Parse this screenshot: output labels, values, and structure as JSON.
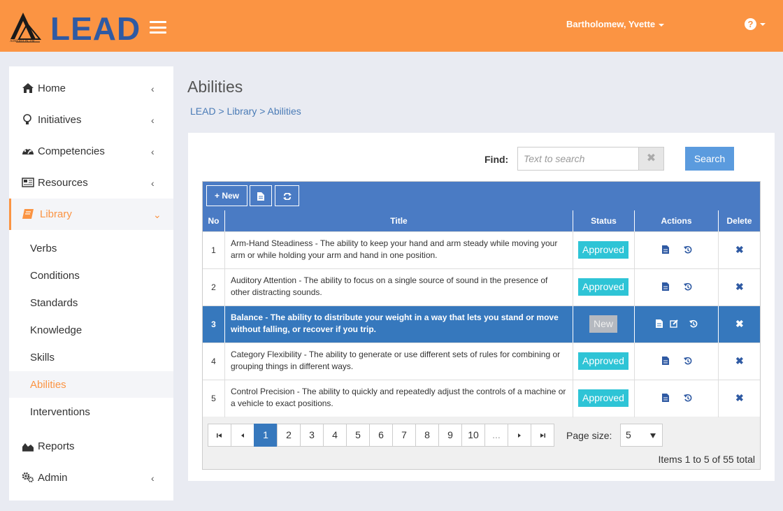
{
  "header": {
    "logo_text": "LEAD",
    "logo_sub": "AIMEREON, INC",
    "user_name": "Bartholomew, Yvette",
    "help_glyph": "?",
    "bg_color": "#fb9443",
    "icons": [
      "hamburger-menu-icon",
      "user-caret-icon",
      "help-icon"
    ]
  },
  "sidebar": {
    "items": [
      {
        "label": "Home",
        "icon": "home-icon",
        "chevron": "‹"
      },
      {
        "label": "Initiatives",
        "icon": "lightbulb-icon",
        "chevron": "‹"
      },
      {
        "label": "Competencies",
        "icon": "dashboard-icon",
        "chevron": "‹"
      },
      {
        "label": "Resources",
        "icon": "newspaper-icon",
        "chevron": "‹"
      },
      {
        "label": "Library",
        "icon": "book-icon",
        "chevron": "⌄",
        "active": true
      },
      {
        "label": "Reports",
        "icon": "area-chart-icon"
      },
      {
        "label": "Admin",
        "icon": "gears-icon",
        "chevron": "‹"
      }
    ],
    "library_children": [
      {
        "label": "Verbs"
      },
      {
        "label": "Conditions"
      },
      {
        "label": "Standards"
      },
      {
        "label": "Knowledge"
      },
      {
        "label": "Skills"
      },
      {
        "label": "Abilities",
        "active": true
      },
      {
        "label": "Interventions"
      }
    ]
  },
  "main": {
    "title": "Abilities",
    "breadcrumb": "LEAD > Library > Abilities",
    "find_label": "Find:",
    "search_placeholder": "Text to search",
    "clear_glyph": "✖",
    "search_button": "Search",
    "toolbar": {
      "new_label": "+ New",
      "export_icon": "document-icon",
      "refresh_icon": "refresh-icon"
    },
    "columns": [
      "No",
      "Title",
      "Status",
      "Actions",
      "Delete"
    ],
    "rows": [
      {
        "no": "1",
        "title": "Arm-Hand Steadiness - The ability to keep your hand and arm steady while moving your arm or while holding your arm and hand in one position.",
        "status": "Approved",
        "selected": false
      },
      {
        "no": "2",
        "title": "Auditory Attention - The ability to focus on a single source of sound in the presence of other distracting sounds.",
        "status": "Approved",
        "selected": false
      },
      {
        "no": "3",
        "title": "Balance - The ability to distribute your weight in a way that lets you stand or move without falling, or recover if you trip.",
        "status": "New",
        "selected": true
      },
      {
        "no": "4",
        "title": "Category Flexibility - The ability to generate or use different sets of rules for combining or grouping things in different ways.",
        "status": "Approved",
        "selected": false
      },
      {
        "no": "5",
        "title": "Control Precision - The ability to quickly and repeatedly adjust the controls of a machine or a vehicle to exact positions.",
        "status": "Approved",
        "selected": false
      }
    ],
    "delete_glyph": "✖",
    "pager": {
      "first": "⏮",
      "prev": "◂",
      "pages": [
        "1",
        "2",
        "3",
        "4",
        "5",
        "6",
        "7",
        "8",
        "9",
        "10",
        "..."
      ],
      "current": "1",
      "next": "▸",
      "last": "⏭",
      "page_size_label": "Page size:",
      "page_size": "5",
      "total_text": "Items 1 to 5 of 55 total"
    },
    "colors": {
      "approved": "#2ec4d6",
      "new": "#b5b9c0",
      "grid_header": "#4a7bc4",
      "selected_row": "#3678bd",
      "accent": "#fb9443"
    }
  }
}
